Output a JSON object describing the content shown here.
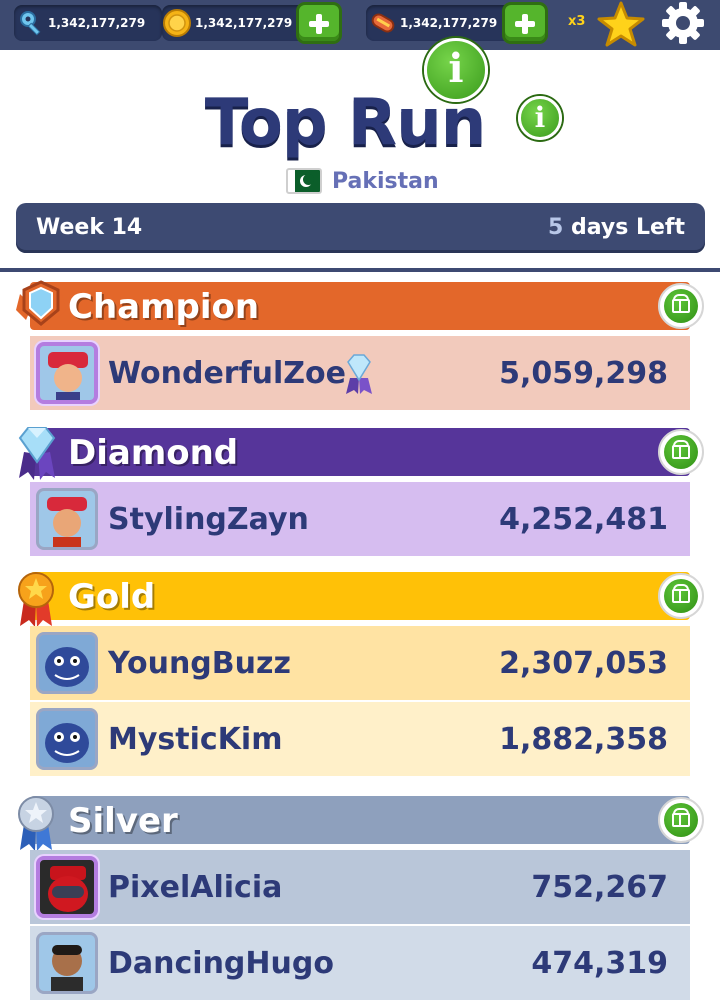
{
  "currency": {
    "keys": "1,342,177,279",
    "coins": "1,342,177,279",
    "hoverboards": "1,342,177,279",
    "multiplier": "x3"
  },
  "header": {
    "title": "Top Run",
    "country": "Pakistan",
    "week": "Week 14",
    "days_number": "5",
    "days_label": " days Left"
  },
  "leagues": [
    {
      "name": "Champion",
      "color": "#e3672a",
      "row_color": "#f2cabc",
      "players": [
        {
          "name": "WonderfulZoe",
          "score": "5,059,298"
        }
      ]
    },
    {
      "name": "Diamond",
      "color": "#56359a",
      "row_color": "#d6bdf0",
      "players": [
        {
          "name": "StylingZayn",
          "score": "4,252,481"
        }
      ]
    },
    {
      "name": "Gold",
      "color": "#ffc107",
      "row_color": "#ffe3a3",
      "players": [
        {
          "name": "YoungBuzz",
          "score": "2,307,053"
        },
        {
          "name": "MysticKim",
          "score": "1,882,358"
        }
      ]
    },
    {
      "name": "Silver",
      "color": "#8ea0bd",
      "row_color": "#b9c6d9",
      "players": [
        {
          "name": "PixelAlicia",
          "score": "752,267"
        },
        {
          "name": "DancingHugo",
          "score": "474,319"
        }
      ]
    }
  ],
  "icons": {
    "key": "key-icon",
    "coin": "coin-icon",
    "hoverboard": "hoverboard-icon",
    "star": "star-icon",
    "settings": "gear-icon",
    "info": "info-icon",
    "gift": "gift-icon"
  }
}
